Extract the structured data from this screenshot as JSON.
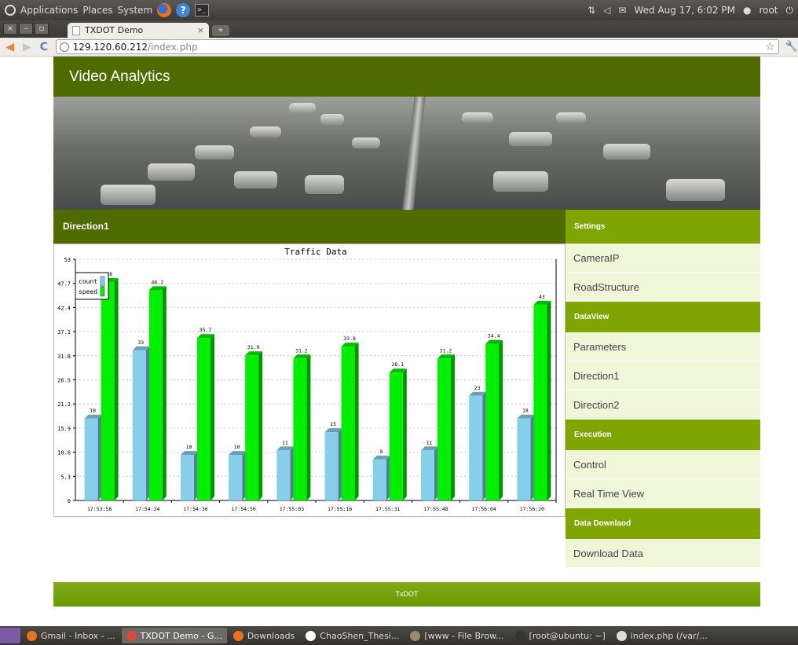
{
  "panel": {
    "menus": [
      "Applications",
      "Places",
      "System"
    ],
    "clock": "Wed Aug 17,  6:02 PM",
    "user": "root"
  },
  "browser": {
    "tab_title": "TXDOT Demo",
    "url_host": "129.120.60.212",
    "url_path": "/index.php"
  },
  "site": {
    "header_title": "Video Analytics",
    "main_heading": "Direction1",
    "footer_text": "TxDOT"
  },
  "sidebar": {
    "sections": [
      {
        "title": "Settings",
        "items": [
          "CameraIP",
          "RoadStructure"
        ]
      },
      {
        "title": "DataView",
        "items": [
          "Parameters",
          "Direction1",
          "Direction2"
        ]
      },
      {
        "title": "Execution",
        "items": [
          "Control",
          "Real Time View"
        ]
      },
      {
        "title": "Data Downlaod",
        "items": [
          "Download Data"
        ]
      }
    ]
  },
  "chart_data": {
    "type": "bar",
    "title": "Traffic Data",
    "xlabel": "",
    "ylabel": "",
    "ylim": [
      0,
      53
    ],
    "yticks": [
      0,
      5.3,
      10.6,
      15.9,
      21.2,
      26.5,
      31.8,
      37.1,
      42.4,
      47.7,
      53
    ],
    "categories": [
      "17:53:58",
      "17:54:24",
      "17:54:36",
      "17:54:50",
      "17:55:03",
      "17:55:16",
      "17:55:31",
      "17:55:48",
      "17:56:04",
      "17:56:20"
    ],
    "series": [
      {
        "name": "count",
        "color": "#87ceeb",
        "values": [
          18,
          33,
          10,
          10,
          11,
          15,
          9,
          11,
          23,
          18
        ]
      },
      {
        "name": "speed",
        "color": "#00ee00",
        "values": [
          48,
          46.2,
          35.7,
          31.9,
          31.2,
          33.8,
          28.1,
          31.2,
          34.4,
          43
        ]
      }
    ],
    "series_labels": [
      [
        "18",
        "33",
        "10",
        "10",
        "11",
        "15",
        "9",
        "11",
        "23",
        "18"
      ],
      [
        "48",
        "46.2",
        "35.7",
        "31.9",
        "31.2",
        "33.8",
        "28.1",
        "31.2",
        "34.4",
        "43"
      ]
    ],
    "grid": true,
    "legend": "top-left"
  },
  "taskbar": [
    {
      "label": "Gmail - Inbox - ...",
      "icon": "firefox-icon",
      "active": false
    },
    {
      "label": "TXDOT Demo - G...",
      "icon": "chrome-icon",
      "active": true
    },
    {
      "label": "Downloads",
      "icon": "firefox-icon",
      "active": false
    },
    {
      "label": "ChaoShen_Thesi...",
      "icon": "document-icon",
      "active": false
    },
    {
      "label": "[www - File Brow...",
      "icon": "folder-icon",
      "active": false
    },
    {
      "label": "[root@ubuntu: ~]",
      "icon": "terminal-icon",
      "active": false
    },
    {
      "label": "index.php (/var/...",
      "icon": "editor-icon",
      "active": false
    }
  ]
}
